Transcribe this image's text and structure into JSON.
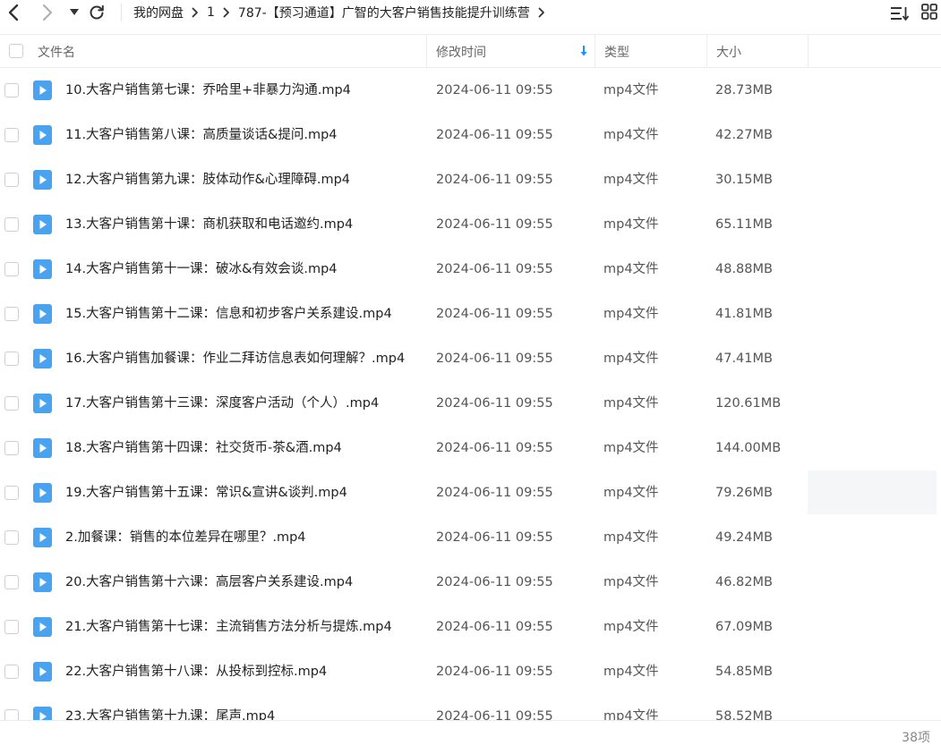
{
  "toolbar": {
    "breadcrumb": [
      "我的网盘",
      "1",
      "787-【预习通道】广智的大客户销售技能提升训练营"
    ]
  },
  "header": {
    "name": "文件名",
    "modified": "修改时间",
    "type": "类型",
    "size": "大小"
  },
  "files": [
    {
      "name": "10.大客户销售第七课：乔哈里+非暴力沟通.mp4",
      "modified": "2024-06-11 09:55",
      "type": "mp4文件",
      "size": "28.73MB"
    },
    {
      "name": "11.大客户销售第八课：高质量谈话&提问.mp4",
      "modified": "2024-06-11 09:55",
      "type": "mp4文件",
      "size": "42.27MB"
    },
    {
      "name": "12.大客户销售第九课：肢体动作&心理障碍.mp4",
      "modified": "2024-06-11 09:55",
      "type": "mp4文件",
      "size": "30.15MB"
    },
    {
      "name": "13.大客户销售第十课：商机获取和电话邀约.mp4",
      "modified": "2024-06-11 09:55",
      "type": "mp4文件",
      "size": "65.11MB"
    },
    {
      "name": "14.大客户销售第十一课：破冰&有效会谈.mp4",
      "modified": "2024-06-11 09:55",
      "type": "mp4文件",
      "size": "48.88MB"
    },
    {
      "name": "15.大客户销售第十二课：信息和初步客户关系建设.mp4",
      "modified": "2024-06-11 09:55",
      "type": "mp4文件",
      "size": "41.81MB"
    },
    {
      "name": "16.大客户销售加餐课：作业二拜访信息表如何理解？.mp4",
      "modified": "2024-06-11 09:55",
      "type": "mp4文件",
      "size": "47.41MB"
    },
    {
      "name": "17.大客户销售第十三课：深度客户活动（个人）.mp4",
      "modified": "2024-06-11 09:55",
      "type": "mp4文件",
      "size": "120.61MB"
    },
    {
      "name": "18.大客户销售第十四课：社交货币-茶&酒.mp4",
      "modified": "2024-06-11 09:55",
      "type": "mp4文件",
      "size": "144.00MB"
    },
    {
      "name": "19.大客户销售第十五课：常识&宣讲&谈判.mp4",
      "modified": "2024-06-11 09:55",
      "type": "mp4文件",
      "size": "79.26MB"
    },
    {
      "name": "2.加餐课：销售的本位差异在哪里？.mp4",
      "modified": "2024-06-11 09:55",
      "type": "mp4文件",
      "size": "49.24MB"
    },
    {
      "name": "20.大客户销售第十六课：高层客户关系建设.mp4",
      "modified": "2024-06-11 09:55",
      "type": "mp4文件",
      "size": "46.82MB"
    },
    {
      "name": "21.大客户销售第十七课：主流销售方法分析与提炼.mp4",
      "modified": "2024-06-11 09:55",
      "type": "mp4文件",
      "size": "67.09MB"
    },
    {
      "name": "22.大客户销售第十八课：从投标到控标.mp4",
      "modified": "2024-06-11 09:55",
      "type": "mp4文件",
      "size": "54.85MB"
    },
    {
      "name": "23.大客户销售第十九课：尾声.mp4",
      "modified": "2024-06-11 09:55",
      "type": "mp4文件",
      "size": "58.52MB"
    }
  ],
  "footer": {
    "count": "38项"
  },
  "colors": {
    "accent": "#1e90ff",
    "file_icon": "#4aa3ef"
  },
  "icons": {
    "back": "chevron-left-icon",
    "forward": "chevron-right-icon",
    "history": "caret-down-icon",
    "refresh": "refresh-icon",
    "sort": "sort-list-icon",
    "grid": "grid-view-icon",
    "file": "video-file-icon"
  }
}
